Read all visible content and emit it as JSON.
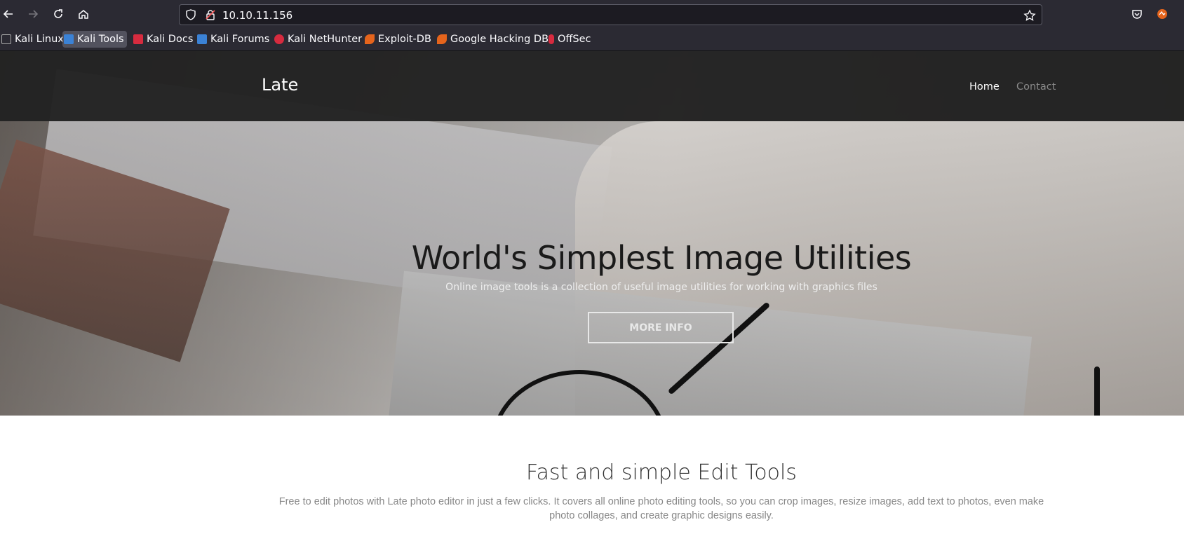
{
  "browser": {
    "url": "10.10.11.156",
    "bookmarks": [
      {
        "label": "Kali Linux",
        "color": "#2b2a33"
      },
      {
        "label": "Kali Tools",
        "color": "#3b82d6"
      },
      {
        "label": "Kali Docs",
        "color": "#d72b3f"
      },
      {
        "label": "Kali Forums",
        "color": "#3b82d6"
      },
      {
        "label": "Kali NetHunter",
        "color": "#d72b3f"
      },
      {
        "label": "Exploit-DB",
        "color": "#e5641c"
      },
      {
        "label": "Google Hacking DB",
        "color": "#e5641c"
      },
      {
        "label": "OffSec",
        "color": "#d72b3f"
      }
    ]
  },
  "site": {
    "brand": "Late",
    "nav": {
      "home": "Home",
      "contact": "Contact"
    },
    "hero": {
      "title": "World's Simplest Image Utilities",
      "subtitle": "Online image tools is a collection of useful image utilities for working with graphics files",
      "button": "MORE INFO"
    },
    "section": {
      "title": "Fast and simple Edit Tools",
      "text": "Free to edit photos with Late photo editor in just a few clicks. It covers all online photo editing tools, so you can crop images, resize images, add text to photos, even make photo collages, and create graphic designs easily."
    }
  }
}
